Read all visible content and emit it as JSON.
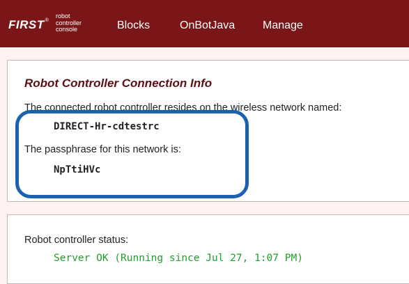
{
  "header": {
    "logo_text": "FIRST",
    "logo_registered": "®",
    "console_lines": [
      "robot",
      "controller",
      "console"
    ],
    "nav": [
      "Blocks",
      "OnBotJava",
      "Manage"
    ]
  },
  "connection": {
    "title": "Robot Controller Connection Info",
    "network_text": "The connected robot controller resides on the wireless network named:",
    "network_name": "DIRECT-Hr-cdtestrc",
    "passphrase_text": "The passphrase for this network is:",
    "passphrase": "NpTtiHVc"
  },
  "status": {
    "label": "Robot controller status:",
    "value": "Server OK (Running since Jul 27, 1:07 PM)"
  },
  "colors": {
    "header_bg": "#7a1518",
    "title": "#5c1014",
    "status_ok": "#1f9e2c",
    "highlight": "#1a62b0"
  }
}
